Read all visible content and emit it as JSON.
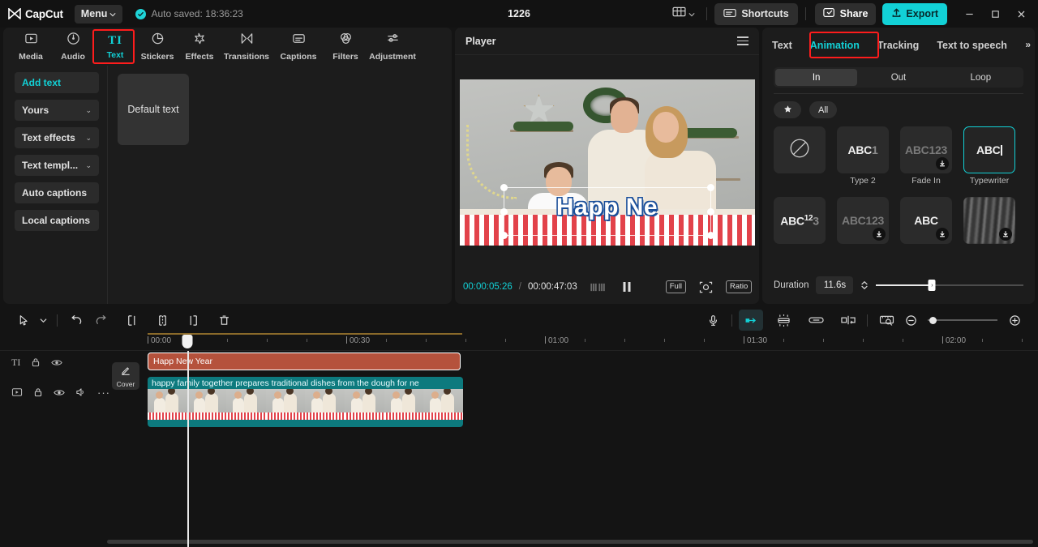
{
  "titlebar": {
    "brand": "CapCut",
    "menu_label": "Menu",
    "autosave_text": "Auto saved: 18:36:23",
    "project_name": "1226",
    "shortcuts_label": "Shortcuts",
    "share_label": "Share",
    "export_label": "Export",
    "accent_color": "#12d1d6",
    "window_controls": [
      "minimize",
      "maximize",
      "close"
    ]
  },
  "left_panel": {
    "tabs": [
      {
        "label": "Media",
        "icon": "media-icon",
        "active": false
      },
      {
        "label": "Audio",
        "icon": "audio-icon",
        "active": false
      },
      {
        "label": "Text",
        "icon": "text-icon",
        "active": true
      },
      {
        "label": "Stickers",
        "icon": "stickers-icon",
        "active": false
      },
      {
        "label": "Effects",
        "icon": "effects-icon",
        "active": false
      },
      {
        "label": "Transitions",
        "icon": "transitions-icon",
        "active": false
      },
      {
        "label": "Captions",
        "icon": "captions-icon",
        "active": false
      },
      {
        "label": "Filters",
        "icon": "filters-icon",
        "active": false
      },
      {
        "label": "Adjustment",
        "icon": "adjustment-icon",
        "active": false
      }
    ],
    "nav_items": [
      {
        "label": "Add text",
        "accent": true,
        "chevron": false
      },
      {
        "label": "Yours",
        "accent": false,
        "chevron": true
      },
      {
        "label": "Text effects",
        "accent": false,
        "chevron": true
      },
      {
        "label": "Text templ...",
        "accent": false,
        "chevron": true
      },
      {
        "label": "Auto captions",
        "accent": false,
        "chevron": false
      },
      {
        "label": "Local captions",
        "accent": false,
        "chevron": false
      }
    ],
    "content_card_label": "Default text"
  },
  "player": {
    "title": "Player",
    "overlay_text": "Happ Ne",
    "current_time": "00:00:05:26",
    "time_separator": "/",
    "total_time": "00:00:47:03",
    "transport_state": "pause",
    "buttons": [
      "Full",
      "Ratio"
    ],
    "full_label": "Full",
    "ratio_label": "Ratio"
  },
  "right_panel": {
    "tabs": [
      {
        "label": "Text",
        "active": false
      },
      {
        "label": "Animation",
        "active": true
      },
      {
        "label": "Tracking",
        "active": false
      },
      {
        "label": "Text to speech",
        "active": false
      }
    ],
    "scroll_indicator": "»",
    "segments": [
      {
        "label": "In",
        "active": true
      },
      {
        "label": "Out",
        "active": false
      },
      {
        "label": "Loop",
        "active": false
      }
    ],
    "filters": [
      {
        "label": "",
        "icon": "star-icon"
      },
      {
        "label": "All",
        "icon": ""
      }
    ],
    "animations": [
      {
        "name": "",
        "thumb": "none-icon",
        "selected": false,
        "downloadable": false,
        "label": ""
      },
      {
        "name": "Type 2",
        "thumb": "ABC1",
        "selected": false,
        "downloadable": false,
        "label": "Type 2"
      },
      {
        "name": "Fade In",
        "thumb": "ABC123",
        "selected": false,
        "downloadable": true,
        "label": "Fade In"
      },
      {
        "name": "Typewriter",
        "thumb": "ABC",
        "selected": true,
        "downloadable": false,
        "label": "Typewriter"
      },
      {
        "name": "",
        "thumb": "ABC123sup",
        "selected": false,
        "downloadable": false,
        "label": ""
      },
      {
        "name": "",
        "thumb": "ABC123",
        "selected": false,
        "downloadable": true,
        "label": ""
      },
      {
        "name": "",
        "thumb": "ABC",
        "selected": false,
        "downloadable": true,
        "label": ""
      },
      {
        "name": "",
        "thumb": "blur",
        "selected": false,
        "downloadable": true,
        "label": ""
      }
    ],
    "duration_label": "Duration",
    "duration_value": "11.6s",
    "duration_slider_percent": 38
  },
  "timeline": {
    "tools": [
      {
        "name": "select-tool",
        "active": false
      },
      {
        "name": "select-dropdown",
        "active": false
      },
      {
        "name": "undo",
        "active": false
      },
      {
        "name": "redo",
        "active": false
      },
      {
        "name": "split-left",
        "active": false
      },
      {
        "name": "split",
        "active": false
      },
      {
        "name": "split-right",
        "active": false
      },
      {
        "name": "delete",
        "active": false
      }
    ],
    "right_tools": [
      {
        "name": "mic",
        "active": false
      },
      {
        "name": "speed-ramp",
        "active": true
      },
      {
        "name": "magnet-snap",
        "active": false
      },
      {
        "name": "link",
        "active": false
      },
      {
        "name": "auto-cut",
        "active": false
      },
      {
        "name": "preview-render",
        "active": false
      }
    ],
    "zoom_out_label": "zoom-out",
    "zoom_in_label": "zoom-in",
    "ruler_labels": [
      "00:00",
      "00:30",
      "01:00",
      "01:30",
      "02:00"
    ],
    "text_track": {
      "icon": "text-track-icon",
      "lock": "lock-icon",
      "visibility": "eye-icon",
      "clip_label": "Happ New Year"
    },
    "video_track": {
      "icon": "video-track-icon",
      "lock": "lock-icon",
      "visibility": "eye-icon",
      "audio": "speaker-icon",
      "more": "more-icon",
      "cover_label": "Cover",
      "clip_label": "happy family together prepares traditional dishes from the dough for ne"
    }
  }
}
